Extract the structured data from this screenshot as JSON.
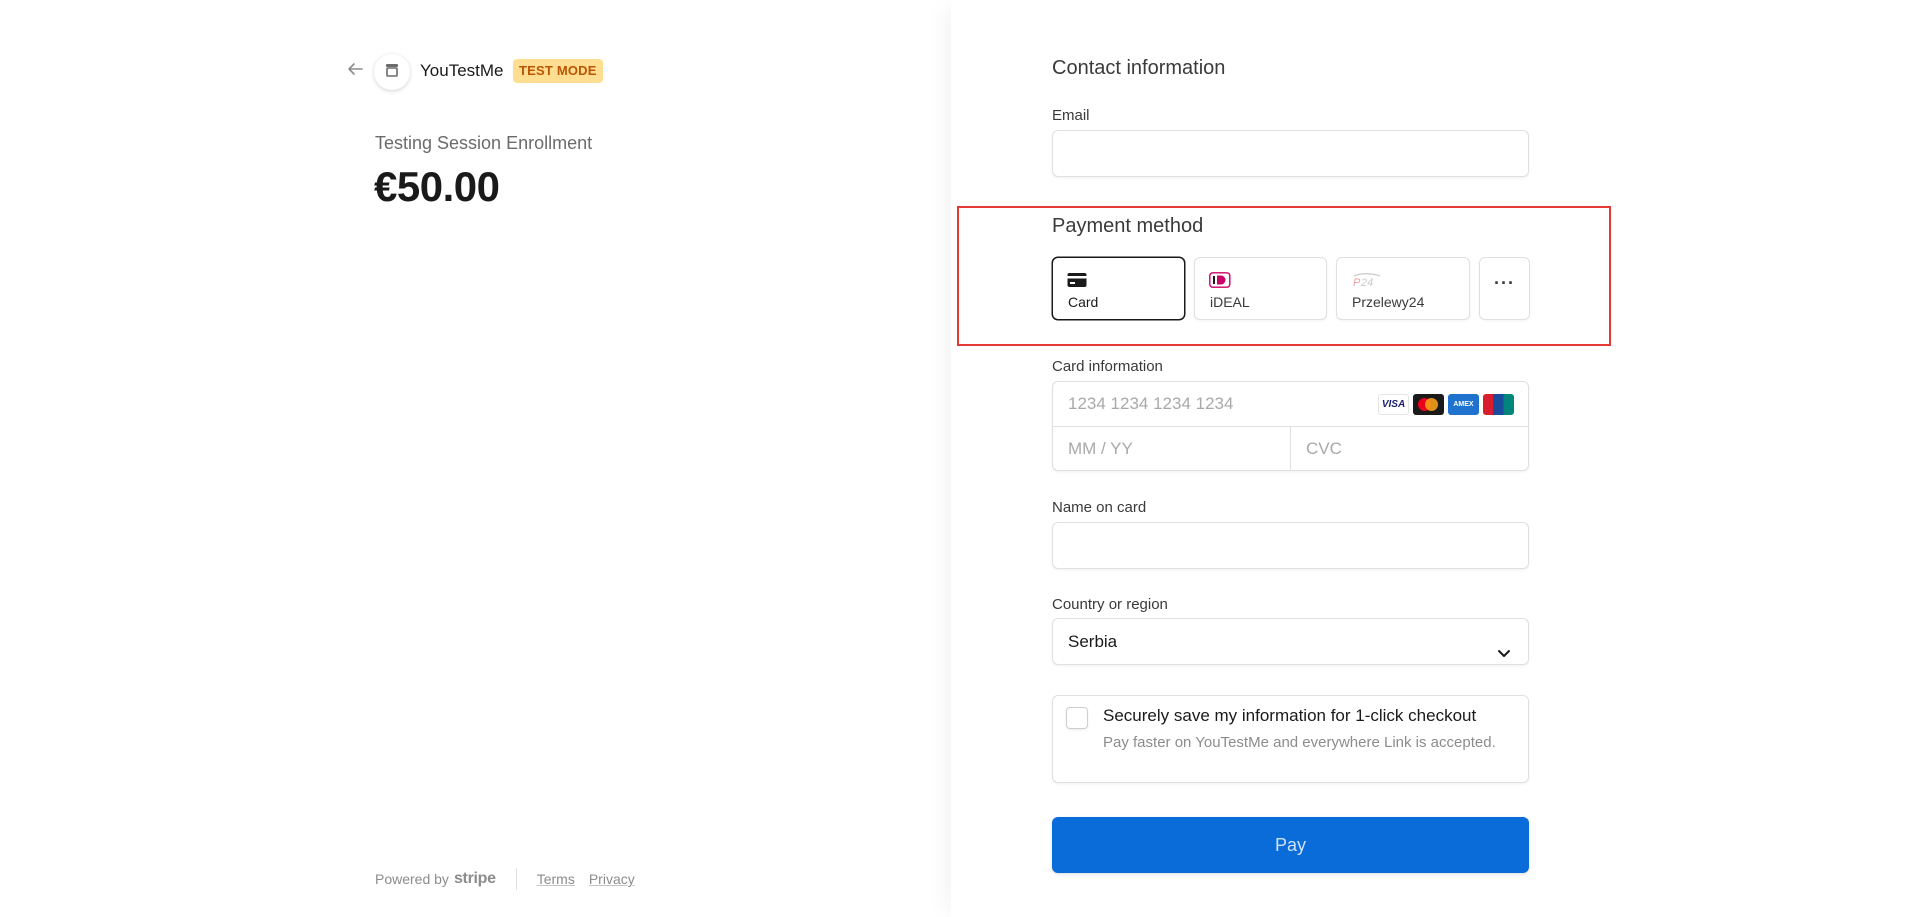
{
  "merchant": {
    "name": "YouTestMe",
    "badge": "TEST MODE",
    "back_icon": "arrow-left-icon",
    "logo_icon": "store-icon"
  },
  "product": {
    "name": "Testing Session Enrollment",
    "price": "€50.00"
  },
  "footer": {
    "powered_by": "Powered by",
    "brand": "stripe",
    "terms": "Terms",
    "privacy": "Privacy"
  },
  "contact": {
    "title": "Contact information",
    "email_label": "Email",
    "email_value": ""
  },
  "payment_method": {
    "title": "Payment method",
    "options": [
      {
        "label": "Card",
        "icon": "credit-card-icon",
        "selected": true
      },
      {
        "label": "iDEAL",
        "icon": "ideal-icon",
        "selected": false
      },
      {
        "label": "Przelewy24",
        "icon": "p24-icon",
        "selected": false
      }
    ],
    "more_label": "···"
  },
  "card": {
    "label": "Card information",
    "number_placeholder": "1234 1234 1234 1234",
    "expiry_placeholder": "MM / YY",
    "cvc_placeholder": "CVC",
    "brands": [
      "VISA",
      "mastercard",
      "AMEX",
      "UnionPay"
    ]
  },
  "name_on_card": {
    "label": "Name on card",
    "value": ""
  },
  "country": {
    "label": "Country or region",
    "selected": "Serbia"
  },
  "save_info": {
    "title": "Securely save my information for 1-click checkout",
    "description": "Pay faster on YouTestMe and everywhere Link is accepted.",
    "checked": false
  },
  "pay": {
    "label": "Pay"
  },
  "colors": {
    "accent": "#0a6cd8",
    "badge_bg": "#ffde92",
    "badge_text": "#bb5504",
    "highlight": "#e53935"
  }
}
